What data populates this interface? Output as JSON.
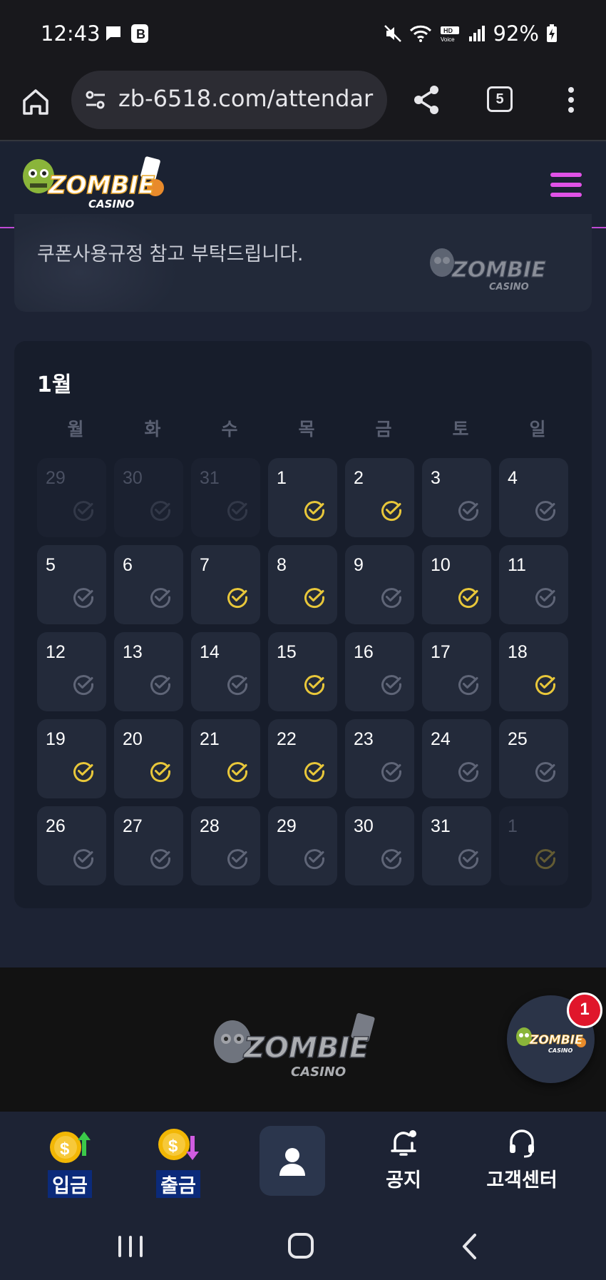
{
  "status_bar": {
    "time": "12:43",
    "battery": "92%"
  },
  "browser": {
    "url": "zb-6518.com/attendar",
    "tab_count": "5"
  },
  "site": {
    "logo_text_main": "ZOMBIE",
    "logo_text_sub": "CASINO"
  },
  "banner": {
    "text": "쿠폰사용규정 참고 부탁드립니다."
  },
  "calendar": {
    "month_label": "1월",
    "weekdays": [
      "월",
      "화",
      "수",
      "목",
      "금",
      "토",
      "일"
    ],
    "days": [
      {
        "n": "29",
        "muted": true,
        "checked": false
      },
      {
        "n": "30",
        "muted": true,
        "checked": false
      },
      {
        "n": "31",
        "muted": true,
        "checked": false
      },
      {
        "n": "1",
        "muted": false,
        "checked": true
      },
      {
        "n": "2",
        "muted": false,
        "checked": true
      },
      {
        "n": "3",
        "muted": false,
        "checked": false
      },
      {
        "n": "4",
        "muted": false,
        "checked": false
      },
      {
        "n": "5",
        "muted": false,
        "checked": false
      },
      {
        "n": "6",
        "muted": false,
        "checked": false
      },
      {
        "n": "7",
        "muted": false,
        "checked": true
      },
      {
        "n": "8",
        "muted": false,
        "checked": true
      },
      {
        "n": "9",
        "muted": false,
        "checked": false
      },
      {
        "n": "10",
        "muted": false,
        "checked": true
      },
      {
        "n": "11",
        "muted": false,
        "checked": false
      },
      {
        "n": "12",
        "muted": false,
        "checked": false
      },
      {
        "n": "13",
        "muted": false,
        "checked": false
      },
      {
        "n": "14",
        "muted": false,
        "checked": false
      },
      {
        "n": "15",
        "muted": false,
        "checked": true
      },
      {
        "n": "16",
        "muted": false,
        "checked": false
      },
      {
        "n": "17",
        "muted": false,
        "checked": false
      },
      {
        "n": "18",
        "muted": false,
        "checked": true
      },
      {
        "n": "19",
        "muted": false,
        "checked": true
      },
      {
        "n": "20",
        "muted": false,
        "checked": true
      },
      {
        "n": "21",
        "muted": false,
        "checked": true
      },
      {
        "n": "22",
        "muted": false,
        "checked": true
      },
      {
        "n": "23",
        "muted": false,
        "checked": false
      },
      {
        "n": "24",
        "muted": false,
        "checked": false
      },
      {
        "n": "25",
        "muted": false,
        "checked": false
      },
      {
        "n": "26",
        "muted": false,
        "checked": false
      },
      {
        "n": "27",
        "muted": false,
        "checked": false
      },
      {
        "n": "28",
        "muted": false,
        "checked": false
      },
      {
        "n": "29",
        "muted": false,
        "checked": false
      },
      {
        "n": "30",
        "muted": false,
        "checked": false
      },
      {
        "n": "31",
        "muted": false,
        "checked": false
      },
      {
        "n": "1",
        "muted": true,
        "checked": true
      }
    ]
  },
  "chat_fab": {
    "badge": "1"
  },
  "bottom_nav": {
    "deposit": "입금",
    "withdraw": "출금",
    "notice": "공지",
    "support": "고객센터"
  },
  "colors": {
    "accent_magenta": "#e052e6",
    "check_yellow": "#e8c73a",
    "check_gray": "#5f6577",
    "badge_red": "#e0162b"
  }
}
